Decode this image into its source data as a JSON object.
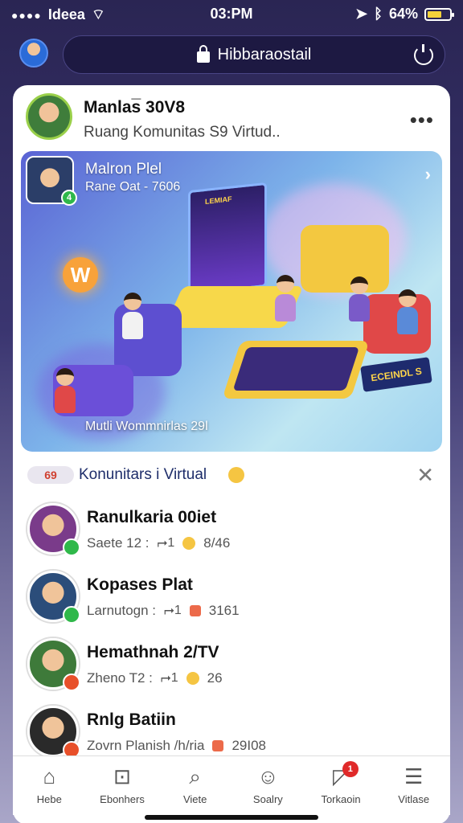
{
  "status_bar": {
    "carrier": "Ideea",
    "time": "03:PM",
    "battery": "64%",
    "battery_level": 0.64
  },
  "browser": {
    "url": "Hibbaraostail"
  },
  "post": {
    "author": "Manlas̅ 30V8",
    "subtitle": "Ruang Komunitas S9 Virtud..",
    "hero": {
      "title": "Malron Plel",
      "subtitle": "Rane Oat - 7606",
      "badge": "4",
      "caption": "Mutli Wommnirlas 29l",
      "screen_text": "LEMIAF",
      "logo_letter": "W",
      "sign_text": "ECEINDL S"
    }
  },
  "section": {
    "chip": "69",
    "title": "Konunitars i Virtual"
  },
  "list": [
    {
      "name": "Ranulkaria 00iet",
      "meta_left": "Saete 12 :",
      "share": "1",
      "count": "8/46",
      "reaction": "emoji",
      "avatar_color": "#7a3b8a"
    },
    {
      "name": "Kopases Plat",
      "meta_left": "Larnutogn :",
      "share": "1",
      "count": "3161",
      "reaction": "square",
      "avatar_color": "#2b4d7a"
    },
    {
      "name": "Hemathnah 2/TV",
      "meta_left": "Zheno T2 :",
      "share": "1",
      "count": "26",
      "reaction": "emoji",
      "avatar_color": "#3e7a3a"
    },
    {
      "name": "Rnlg Batiin",
      "meta_left": "Zovrn Planish /h/ria",
      "share": "",
      "count": "29I08",
      "reaction": "square",
      "avatar_color": "#2a2a2a"
    }
  ],
  "tabs": [
    {
      "label": "Hebe",
      "icon": "home-icon"
    },
    {
      "label": "Ebonhers",
      "icon": "bookmark-icon"
    },
    {
      "label": "Viete",
      "icon": "search-icon"
    },
    {
      "label": "Soalry",
      "icon": "smile-icon"
    },
    {
      "label": "Torkaoin",
      "icon": "chat-icon",
      "badge": "1"
    },
    {
      "label": "Vitlase",
      "icon": "menu-icon"
    }
  ]
}
